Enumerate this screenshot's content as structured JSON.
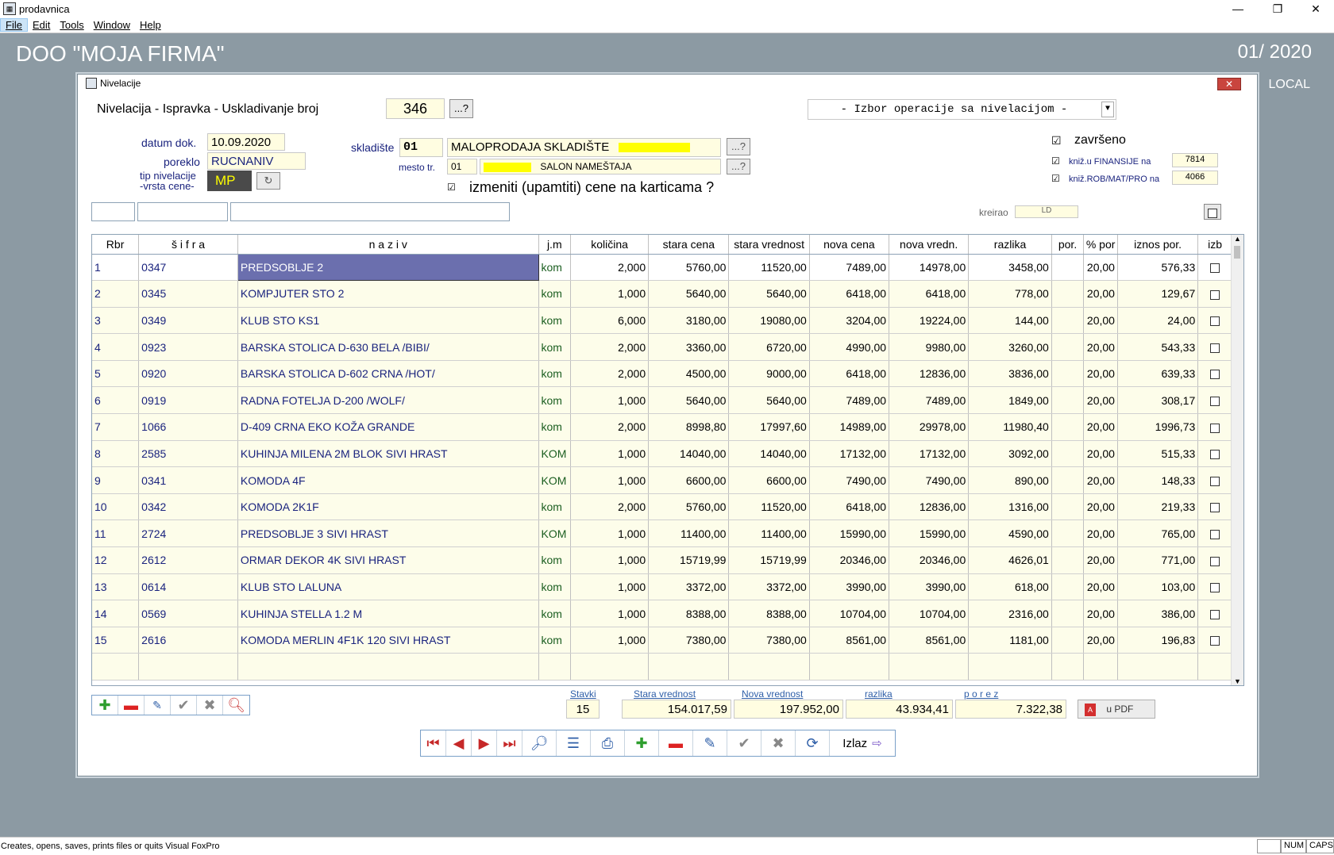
{
  "app": {
    "title": "prodavnica",
    "menu": [
      "File",
      "Edit",
      "Tools",
      "Window",
      "Help"
    ],
    "minimize": "—",
    "restore": "❐",
    "close": "✕"
  },
  "header": {
    "firm": "DOO  \"MOJA FIRMA\"",
    "period": "01/ 2020",
    "local": "LOCAL"
  },
  "window": {
    "title": "Nivelacije",
    "close": "✕"
  },
  "form": {
    "heading": "Nivelacija - Ispravka - Uskladivanje  broj",
    "broj": "346",
    "lookup": "...?",
    "operation": "- Izbor operacije sa nivelacijom -",
    "datum_label": "datum dok.",
    "datum": "10.09.2020",
    "poreklo_label": "poreklo",
    "poreklo": "RUCNANIV",
    "tip_label1": "tip nivelacije",
    "tip_label2": "-vrsta cene-",
    "tip": "MP",
    "skladiste_label": "skladište",
    "skladiste_code": "01",
    "skladiste_name": "MALOPRODAJA SKLADIŠTE",
    "mesto_label": "mesto tr.",
    "mesto_code": "01",
    "mesto_name": "SALON NAMEŠTAJA",
    "izmeniti": "izmeniti (upamtiti) cene na karticama  ?",
    "zavrseno": "završeno",
    "knjiz_fin": "kniž.u FINANSIJE na",
    "knjiz_fin_val": "7814",
    "knjiz_rob": "kniž.ROB/MAT/PRO na",
    "knjiz_rob_val": "4066",
    "kreirao_label": "kreirao",
    "kreirao": "LD",
    "checkmark": "☑"
  },
  "table": {
    "columns": [
      "Rbr",
      "š i f r a",
      "n a z i v",
      "j.m",
      "količina",
      "stara cena",
      "stara vrednost",
      "nova cena",
      "nova vredn.",
      "razlika",
      "por.",
      "% por",
      "iznos por.",
      "izb"
    ],
    "rows": [
      [
        "1",
        "0347",
        "PREDSOBLJE 2",
        "kom",
        "2,000",
        "5760,00",
        "11520,00",
        "7489,00",
        "14978,00",
        "3458,00",
        "",
        "20,00",
        "576,33"
      ],
      [
        "2",
        "0345",
        "KOMPJUTER STO 2",
        "kom",
        "1,000",
        "5640,00",
        "5640,00",
        "6418,00",
        "6418,00",
        "778,00",
        "",
        "20,00",
        "129,67"
      ],
      [
        "3",
        "0349",
        "KLUB STO KS1",
        "kom",
        "6,000",
        "3180,00",
        "19080,00",
        "3204,00",
        "19224,00",
        "144,00",
        "",
        "20,00",
        "24,00"
      ],
      [
        "4",
        "0923",
        "BARSKA STOLICA D-630 BELA /BIBI/",
        "kom",
        "2,000",
        "3360,00",
        "6720,00",
        "4990,00",
        "9980,00",
        "3260,00",
        "",
        "20,00",
        "543,33"
      ],
      [
        "5",
        "0920",
        "BARSKA STOLICA D-602 CRNA /HOT/",
        "kom",
        "2,000",
        "4500,00",
        "9000,00",
        "6418,00",
        "12836,00",
        "3836,00",
        "",
        "20,00",
        "639,33"
      ],
      [
        "6",
        "0919",
        "RADNA FOTELJA D-200 /WOLF/",
        "kom",
        "1,000",
        "5640,00",
        "5640,00",
        "7489,00",
        "7489,00",
        "1849,00",
        "",
        "20,00",
        "308,17"
      ],
      [
        "7",
        "1066",
        "D-409 CRNA EKO KOŽA GRANDE",
        "kom",
        "2,000",
        "8998,80",
        "17997,60",
        "14989,00",
        "29978,00",
        "11980,40",
        "",
        "20,00",
        "1996,73"
      ],
      [
        "8",
        "2585",
        "KUHINJA MILENA 2M BLOK SIVI HRAST",
        "KOM",
        "1,000",
        "14040,00",
        "14040,00",
        "17132,00",
        "17132,00",
        "3092,00",
        "",
        "20,00",
        "515,33"
      ],
      [
        "9",
        "0341",
        "KOMODA 4F",
        "KOM",
        "1,000",
        "6600,00",
        "6600,00",
        "7490,00",
        "7490,00",
        "890,00",
        "",
        "20,00",
        "148,33"
      ],
      [
        "10",
        "0342",
        "KOMODA 2K1F",
        "kom",
        "2,000",
        "5760,00",
        "11520,00",
        "6418,00",
        "12836,00",
        "1316,00",
        "",
        "20,00",
        "219,33"
      ],
      [
        "11",
        "2724",
        "PREDSOBLJE 3 SIVI HRAST",
        "KOM",
        "1,000",
        "11400,00",
        "11400,00",
        "15990,00",
        "15990,00",
        "4590,00",
        "",
        "20,00",
        "765,00"
      ],
      [
        "12",
        "2612",
        "ORMAR DEKOR 4K SIVI HRAST",
        "kom",
        "1,000",
        "15719,99",
        "15719,99",
        "20346,00",
        "20346,00",
        "4626,01",
        "",
        "20,00",
        "771,00"
      ],
      [
        "13",
        "0614",
        "KLUB STO LALUNA",
        "kom",
        "1,000",
        "3372,00",
        "3372,00",
        "3990,00",
        "3990,00",
        "618,00",
        "",
        "20,00",
        "103,00"
      ],
      [
        "14",
        "0569",
        "KUHINJA STELLA 1.2 M",
        "kom",
        "1,000",
        "8388,00",
        "8388,00",
        "10704,00",
        "10704,00",
        "2316,00",
        "",
        "20,00",
        "386,00"
      ],
      [
        "15",
        "2616",
        "KOMODA MERLIN 4F1K 120 SIVI HRAST",
        "kom",
        "1,000",
        "7380,00",
        "7380,00",
        "8561,00",
        "8561,00",
        "1181,00",
        "",
        "20,00",
        "196,83"
      ]
    ]
  },
  "summary": {
    "stavki_label": "Stavki",
    "stavki": "15",
    "stara_label": "Stara vrednost",
    "stara": "154.017,59",
    "nova_label": "Nova vrednost",
    "nova": "197.952,00",
    "razlika_label": "razlika",
    "razlika": "43.934,41",
    "porez_label": "p o r e z",
    "porez": "7.322,38",
    "pdf": "u  PDF"
  },
  "toolbar": {
    "izlaz": "Izlaz"
  },
  "status": {
    "text": "Creates, opens, saves, prints files or quits Visual FoxPro",
    "num": "NUM",
    "caps": "CAPS"
  }
}
